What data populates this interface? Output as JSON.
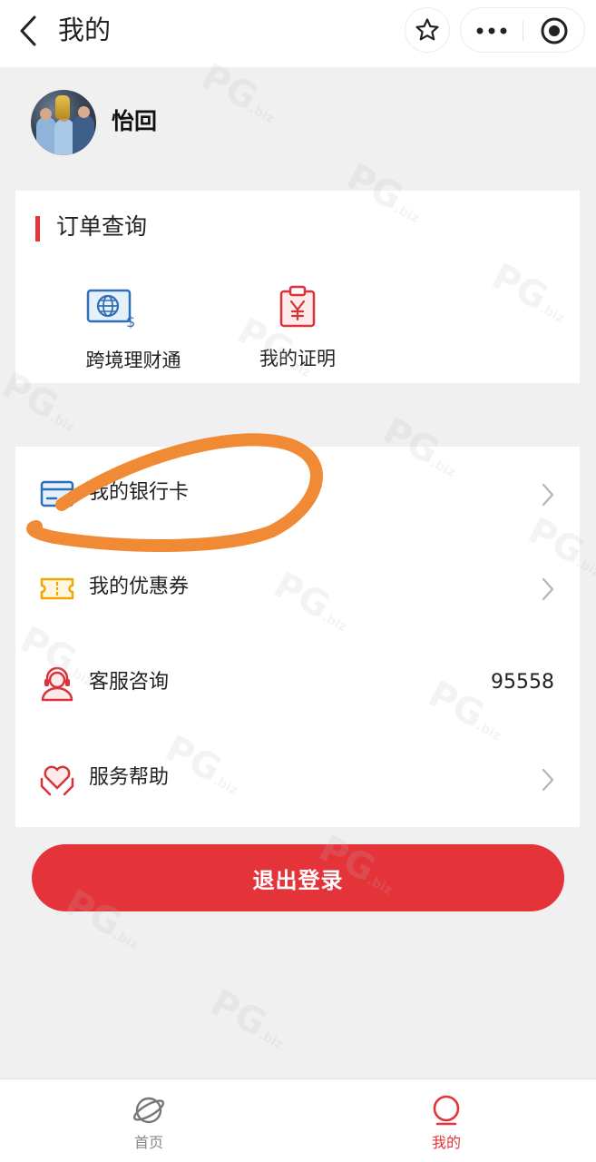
{
  "header": {
    "title": "我的"
  },
  "profile": {
    "username": "怡回"
  },
  "orders": {
    "title": "订单查询",
    "entries": [
      {
        "label": "跨境理财通",
        "icon": "globe-card-icon"
      },
      {
        "label": "我的证明",
        "icon": "yuan-clipboard-icon"
      }
    ]
  },
  "menu": {
    "items": [
      {
        "label": "我的银行卡",
        "icon": "bank-card-icon"
      },
      {
        "label": "我的优惠券",
        "icon": "coupon-icon"
      },
      {
        "label": "客服咨询",
        "icon": "customer-service-icon",
        "value": "95558"
      },
      {
        "label": "服务帮助",
        "icon": "heart-hands-icon"
      }
    ]
  },
  "logout": {
    "label": "退出登录"
  },
  "tabbar": {
    "items": [
      {
        "label": "首页",
        "icon": "planet-icon",
        "active": false
      },
      {
        "label": "我的",
        "icon": "person-icon",
        "active": true
      }
    ]
  },
  "colors": {
    "accent": "#e5333a",
    "annotation": "#f08a35",
    "card_icon_blue": "#2f6fb6",
    "coupon_yellow": "#f0a500"
  }
}
